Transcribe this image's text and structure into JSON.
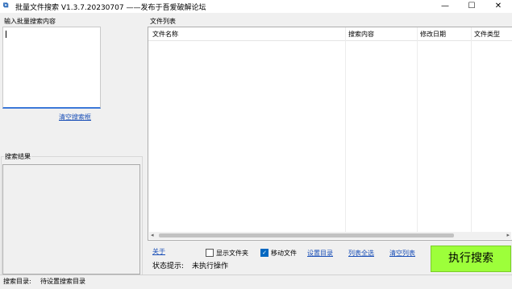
{
  "window": {
    "icon": "app-icon",
    "title": "批量文件搜索 V1.3.7.20230707 ——发布于吾爱破解论坛",
    "minimize": "—",
    "maximize": "☐",
    "close": "✕"
  },
  "left": {
    "input_label": "输入批量搜索内容",
    "input_value": "",
    "clear_search_link": "清空搜索框",
    "result_label": "搜索结果",
    "result_value": ""
  },
  "filelist": {
    "label": "文件列表",
    "columns": [
      "文件名称",
      "搜索内容",
      "修改日期",
      "文件类型"
    ],
    "rows": []
  },
  "controls": {
    "about_link": "关于",
    "show_folder_label": "显示文件夹",
    "show_folder_checked": false,
    "move_file_label": "移动文件",
    "move_file_checked": true,
    "set_dir_link": "设置目录",
    "select_all_link": "列表全选",
    "clear_list_link": "清空列表",
    "status_label": "状态提示:",
    "status_value": "未执行操作",
    "execute_button": "执行搜索",
    "execute_color": "#9dff3a"
  },
  "statusbar": {
    "dir_label": "搜索目录:",
    "dir_value": "待设置搜索目录"
  }
}
